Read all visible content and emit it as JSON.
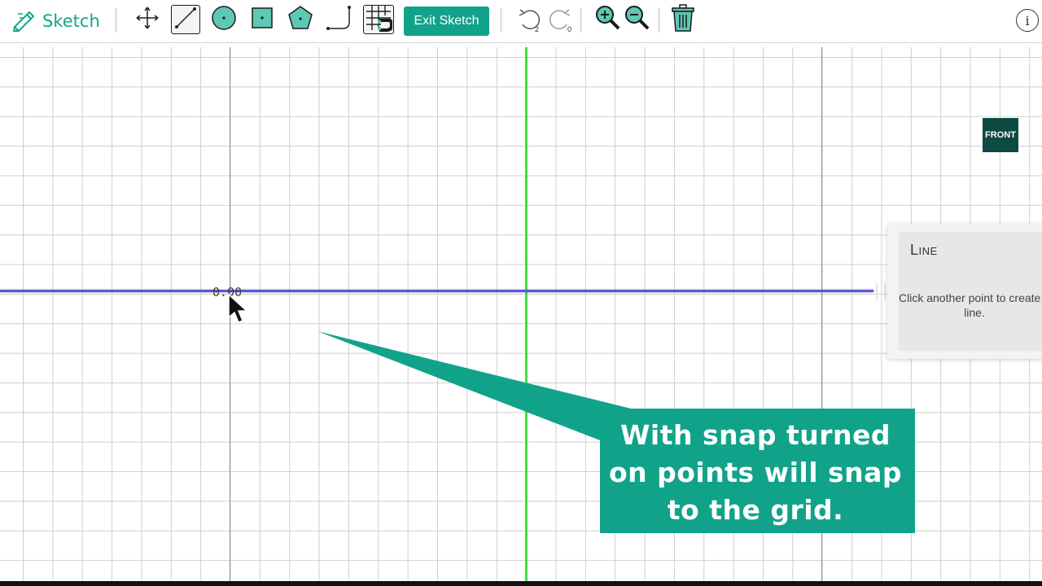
{
  "toolbar": {
    "brand_label": "Sketch",
    "exit_label": "Exit Sketch",
    "undo_count": "2",
    "redo_count": "0",
    "info_label": "i",
    "tools": [
      {
        "name": "move-tool",
        "icon": "crosshair-arrows-icon",
        "active": false
      },
      {
        "name": "line-tool",
        "icon": "line-icon",
        "active": true
      },
      {
        "name": "circle-tool",
        "icon": "circle-icon",
        "active": false
      },
      {
        "name": "rectangle-tool",
        "icon": "square-icon",
        "active": false
      },
      {
        "name": "polygon-tool",
        "icon": "pentagon-icon",
        "active": false
      },
      {
        "name": "polyline-tool",
        "icon": "polyline-icon",
        "active": false
      },
      {
        "name": "snap-grid-tool",
        "icon": "grid-magnet-icon",
        "active": false
      }
    ]
  },
  "canvas": {
    "coordinate_readout": "0.00",
    "view_badge": "FRONT",
    "accent_color": "#11a38a",
    "line_color": "#5a57d2",
    "axis_color": "#40e040"
  },
  "line_panel": {
    "title": "Line",
    "instruction": "Click another point to create a line."
  },
  "callout": {
    "text": "With snap turned on points will snap to the grid."
  }
}
